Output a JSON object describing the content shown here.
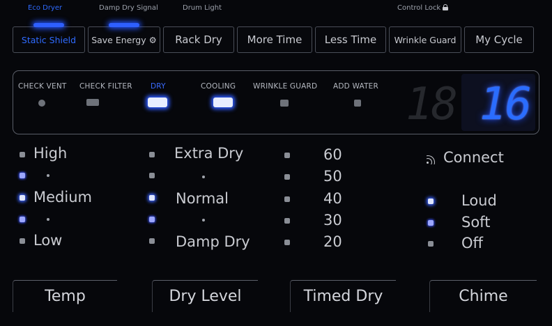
{
  "top_labels": [
    {
      "name": "top-label-eco",
      "text": "Eco Dryer",
      "active": true
    },
    {
      "name": "top-label-damp",
      "text": "Damp Dry Signal",
      "active": false
    },
    {
      "name": "top-label-drum",
      "text": "Drum Light",
      "active": false
    },
    {
      "name": "top-label-control-lock",
      "text": "Control Lock",
      "active": false
    }
  ],
  "cycle_buttons": [
    {
      "label": "Static Shield",
      "active": true
    },
    {
      "label": "Save Energy ⚙",
      "active": true
    },
    {
      "label": "Rack Dry",
      "active": false
    },
    {
      "label": "More Time",
      "active": false
    },
    {
      "label": "Less Time",
      "active": false
    },
    {
      "label": "Wrinkle Guard",
      "active": false
    },
    {
      "label": "My Cycle",
      "active": false
    }
  ],
  "indicators": [
    {
      "label": "CHECK VENT",
      "state": "off"
    },
    {
      "label": "CHECK FILTER",
      "state": "off"
    },
    {
      "label": "DRY",
      "state": "on"
    },
    {
      "label": "COOLING",
      "state": "on"
    },
    {
      "label": "WRINKLE GUARD",
      "state": "off"
    },
    {
      "label": "ADD WATER",
      "state": "off"
    }
  ],
  "display": {
    "ghost": "18",
    "value": "16"
  },
  "temp_options": {
    "high": "High",
    "medium": "Medium",
    "low": "Low",
    "dots": "•"
  },
  "dry_options": {
    "extra": "Extra Dry",
    "normal": "Normal",
    "damp": "Damp Dry",
    "dots": "•"
  },
  "time_options": [
    "60",
    "50",
    "40",
    "30",
    "20"
  ],
  "chime": {
    "connect": "Connect",
    "options": [
      "Loud",
      "Soft",
      "Off"
    ]
  },
  "bottom_buttons": {
    "temp": "Temp",
    "dry_level": "Dry Level",
    "timed_dry": "Timed Dry",
    "chime": "Chime"
  },
  "colors": {
    "accent": "#2f6bff",
    "background": "#06070b"
  }
}
